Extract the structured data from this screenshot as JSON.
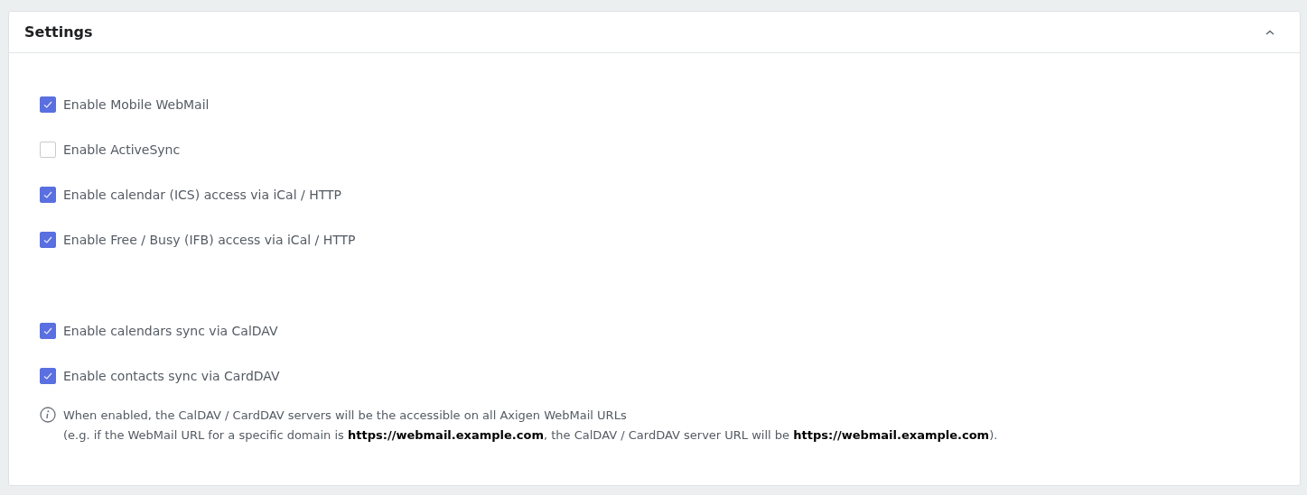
{
  "panel": {
    "title": "Settings",
    "expanded": true
  },
  "groups": [
    {
      "options": [
        {
          "label": "Enable Mobile WebMail",
          "checked": true
        },
        {
          "label": "Enable ActiveSync",
          "checked": false
        },
        {
          "label": "Enable calendar (ICS) access via iCal / HTTP",
          "checked": true
        },
        {
          "label": "Enable Free / Busy (IFB) access via iCal / HTTP",
          "checked": true
        }
      ]
    },
    {
      "options": [
        {
          "label": "Enable calendars sync via CalDAV",
          "checked": true
        },
        {
          "label": "Enable contacts sync via CardDAV",
          "checked": true
        }
      ]
    }
  ],
  "info": {
    "lines": [
      "When enabled, the CalDAV / CardDAV servers will be the accessible on all Axigen WebMail URLs",
      "(e.g. if the WebMail URL for a specific domain is **https://webmail.example.com**, the CalDAV / CardDAV server URL will be **https://webmail.example.com**)."
    ]
  }
}
